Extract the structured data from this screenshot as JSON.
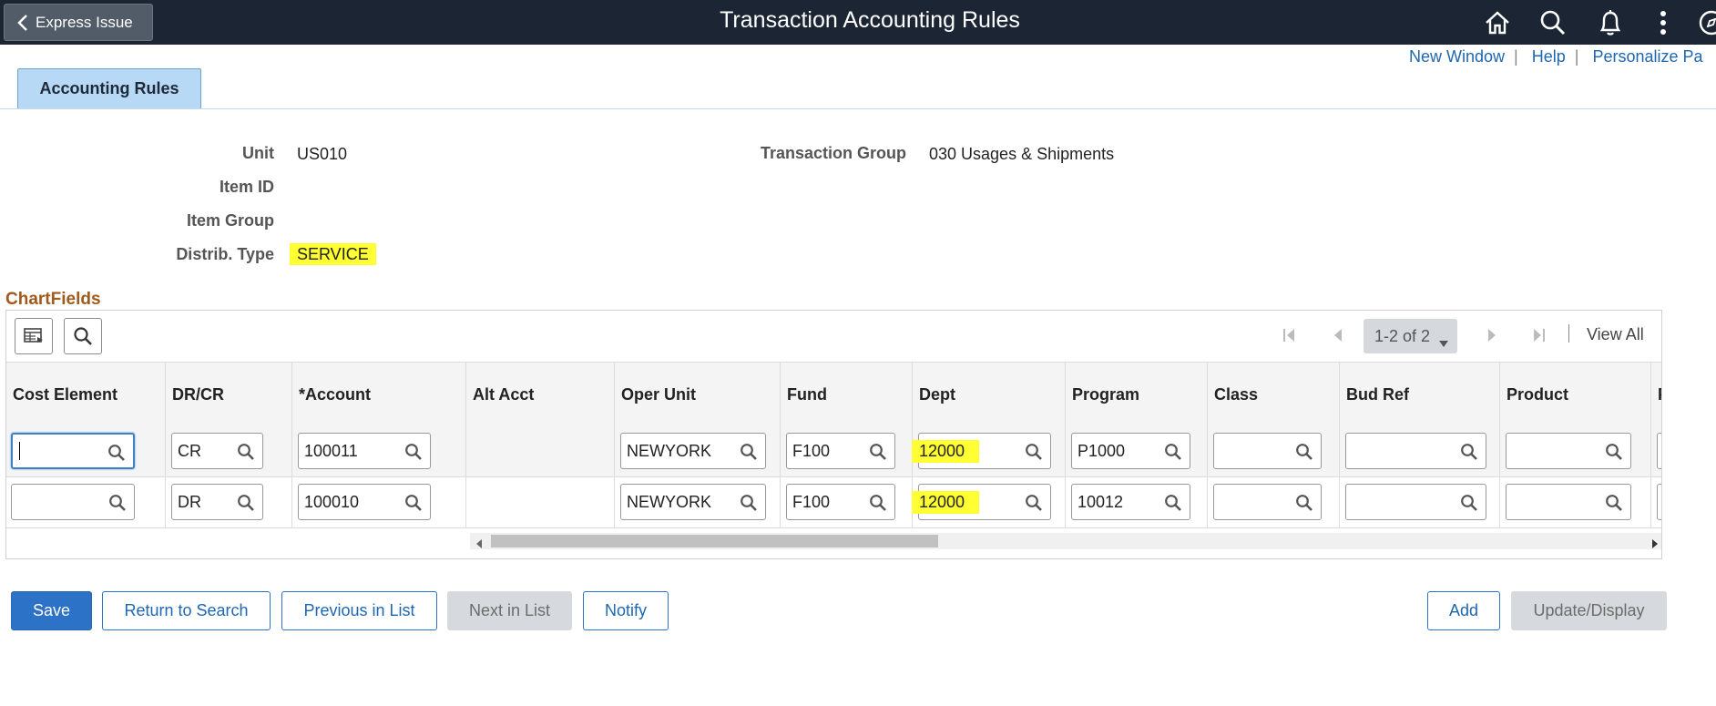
{
  "banner": {
    "back_label": "Express Issue",
    "title": "Transaction Accounting Rules",
    "icons": [
      "home-icon",
      "search-icon",
      "notification-bell-icon",
      "kebab-menu-icon",
      "compass-icon"
    ]
  },
  "top_links": [
    "New Window",
    "Help",
    "Personalize Pa"
  ],
  "tab": {
    "label": "Accounting Rules"
  },
  "header": {
    "unit_label": "Unit",
    "unit_value": "US010",
    "item_id_label": "Item ID",
    "item_group_label": "Item Group",
    "distrib_type_label": "Distrib. Type",
    "distrib_type_value": "SERVICE",
    "trans_group_label": "Transaction Group",
    "trans_group_value": "030 Usages & Shipments"
  },
  "chartfields": {
    "title": "ChartFields",
    "pager": {
      "range": "1-2 of 2",
      "view_all": "View All"
    },
    "columns": [
      "Cost Element",
      "DR/CR",
      "*Account",
      "Alt Acct",
      "Oper Unit",
      "Fund",
      "Dept",
      "Program",
      "Class",
      "Bud Ref",
      "Product",
      "P"
    ],
    "rows": [
      {
        "cost_element": "",
        "drcr": "CR",
        "account": "100011",
        "oper_unit": "NEWYORK",
        "fund": "F100",
        "dept": "12000",
        "program": "P1000",
        "class": "",
        "bud_ref": "",
        "product": ""
      },
      {
        "cost_element": "",
        "drcr": "DR",
        "account": "100010",
        "oper_unit": "NEWYORK",
        "fund": "F100",
        "dept": "12000",
        "program": "10012",
        "class": "",
        "bud_ref": "",
        "product": ""
      }
    ]
  },
  "buttons": {
    "save": "Save",
    "return_to_search": "Return to Search",
    "previous_in_list": "Previous in List",
    "next_in_list": "Next in List",
    "notify": "Notify",
    "add": "Add",
    "update_display": "Update/Display"
  },
  "colors": {
    "banner": "#1b2533",
    "highlight": "#ffff33",
    "primary": "#2c72c6",
    "section_title": "#a05a1c"
  }
}
